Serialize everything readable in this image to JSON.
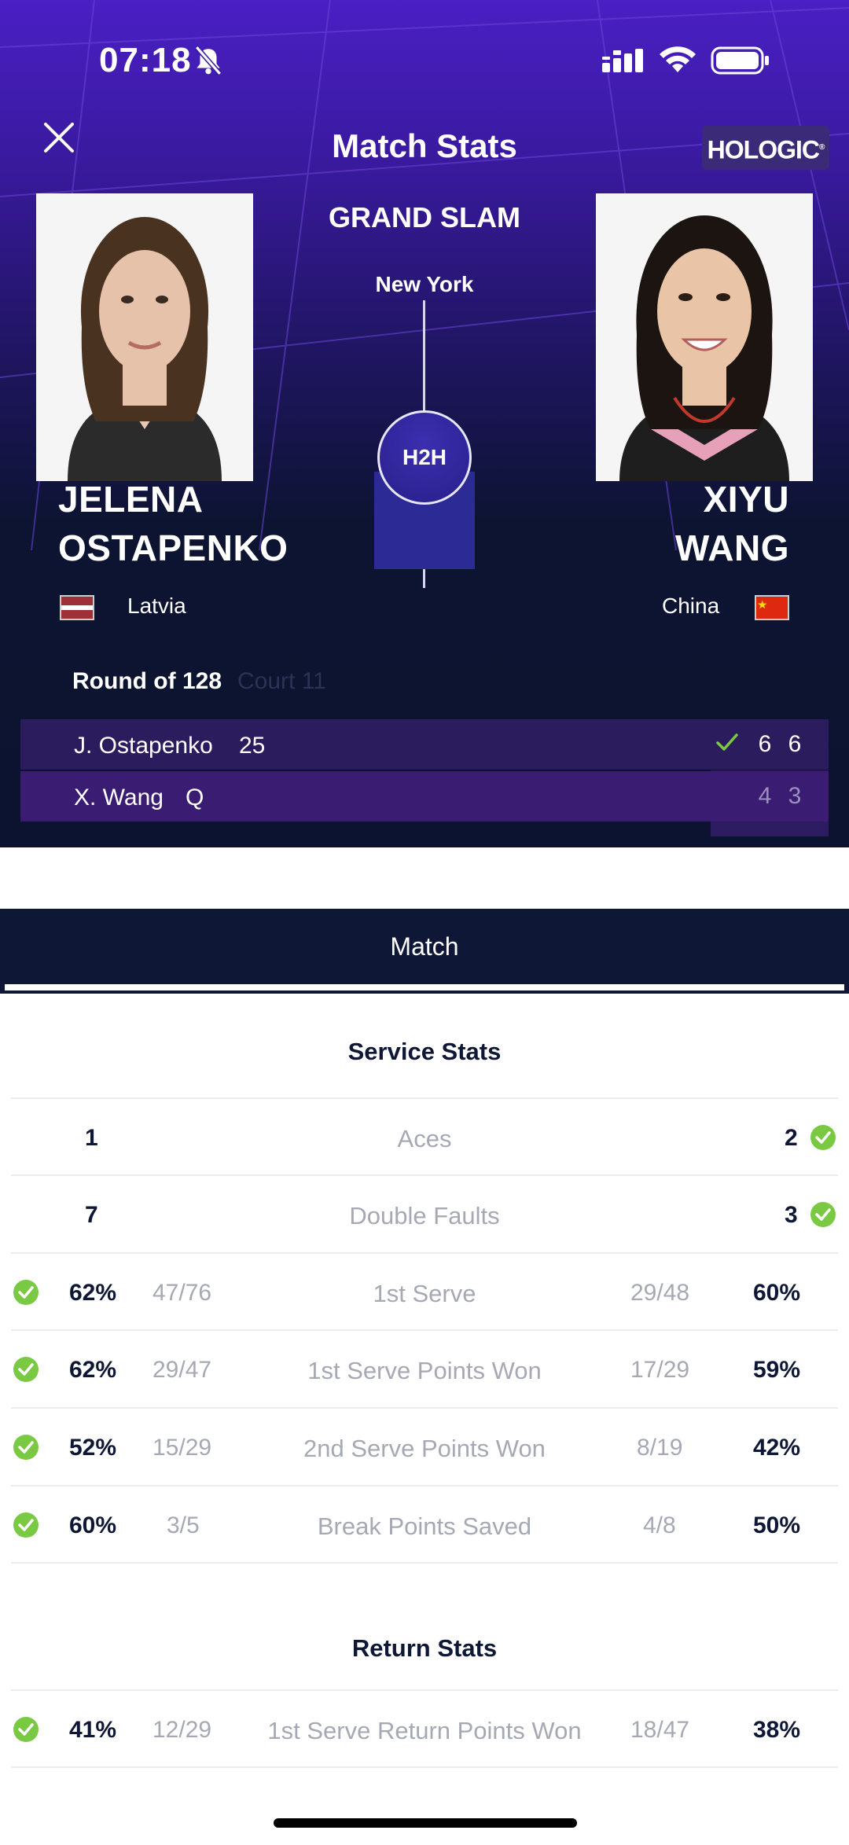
{
  "status_bar": {
    "time": "07:18"
  },
  "header": {
    "title": "Match Stats",
    "sponsor": "HOLOGIC"
  },
  "match": {
    "tournament": "GRAND SLAM",
    "city": "New York",
    "h2h_label": "H2H",
    "round": "Round of 128",
    "court": "Court 11"
  },
  "players": {
    "left": {
      "first": "JELENA",
      "last": "OSTAPENKO",
      "country": "Latvia"
    },
    "right": {
      "first": "XIYU",
      "last": "WANG",
      "country": "China"
    }
  },
  "score": {
    "rows": [
      {
        "name": "J. Ostapenko",
        "seed": "25",
        "sets": [
          "6",
          "6"
        ],
        "winner": true
      },
      {
        "name": "X. Wang",
        "seed": "Q",
        "sets": [
          "4",
          "3"
        ],
        "winner": false
      }
    ]
  },
  "tabs": {
    "active": "Match"
  },
  "service_stats": {
    "title": "Service Stats",
    "rows": [
      {
        "label": "Aces",
        "left": "1",
        "right": "2",
        "winner": "right"
      },
      {
        "label": "Double Faults",
        "left": "7",
        "right": "3",
        "winner": "right"
      },
      {
        "label": "1st Serve",
        "left_pct": "62%",
        "left_frac": "47/76",
        "right_frac": "29/48",
        "right_pct": "60%",
        "winner": "left"
      },
      {
        "label": "1st Serve Points Won",
        "left_pct": "62%",
        "left_frac": "29/47",
        "right_frac": "17/29",
        "right_pct": "59%",
        "winner": "left"
      },
      {
        "label": "2nd Serve Points Won",
        "left_pct": "52%",
        "left_frac": "15/29",
        "right_frac": "8/19",
        "right_pct": "42%",
        "winner": "left"
      },
      {
        "label": "Break Points Saved",
        "left_pct": "60%",
        "left_frac": "3/5",
        "right_frac": "4/8",
        "right_pct": "50%",
        "winner": "left"
      }
    ]
  },
  "return_stats": {
    "title": "Return Stats",
    "rows": [
      {
        "label": "1st Serve Return Points Won",
        "left_pct": "41%",
        "left_frac": "12/29",
        "right_frac": "18/47",
        "right_pct": "38%",
        "winner": "left"
      }
    ]
  },
  "colors": {
    "win_check": "#7ac943",
    "navy": "#0e1735",
    "purple": "#4a1fc4"
  }
}
